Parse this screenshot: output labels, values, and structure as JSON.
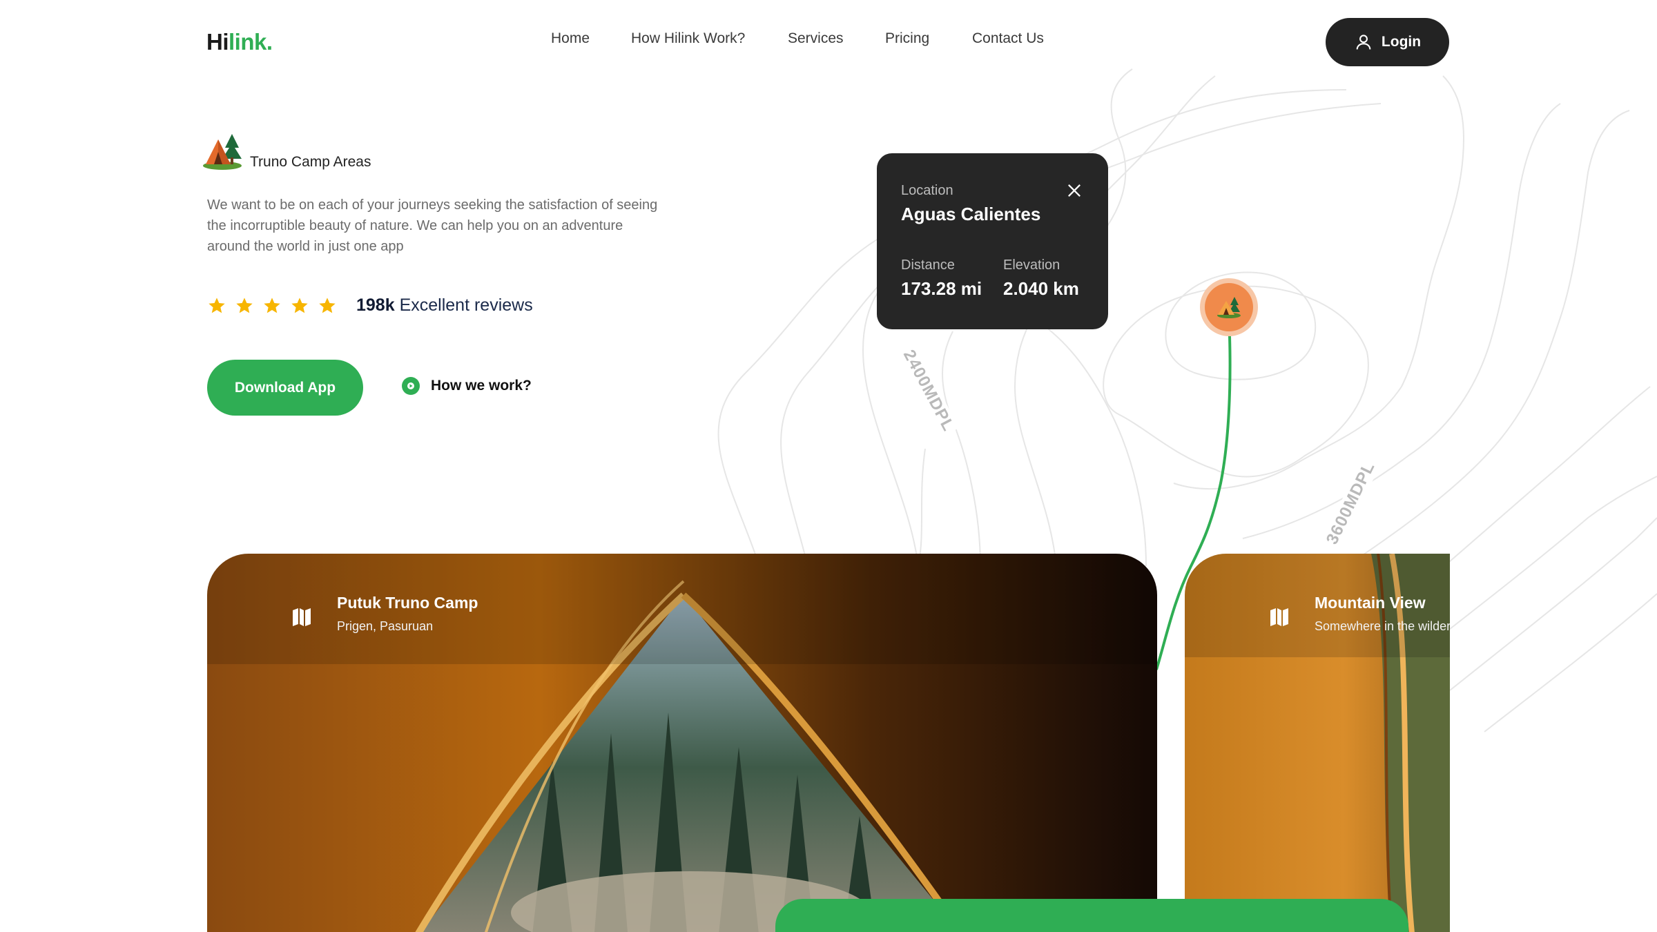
{
  "header": {
    "logo_part1": "Hi",
    "logo_part2": "link.",
    "nav": [
      "Home",
      "How Hilink Work?",
      "Services",
      "Pricing",
      "Contact Us"
    ],
    "login_label": "Login"
  },
  "hero": {
    "badge_label": "Truno Camp Areas",
    "description": "We want to be on each of your journeys seeking the satisfaction of seeing the incorruptible beauty of nature. We can help you on an adventure around the world in just one app",
    "rating_stars": 5,
    "reviews_count": "198k",
    "reviews_label": "Excellent reviews",
    "download_label": "Download App",
    "how_label": "How we work?"
  },
  "location_card": {
    "location_label": "Location",
    "location_name": "Aguas Calientes",
    "distance_label": "Distance",
    "distance_value": "173.28 mi",
    "elevation_label": "Elevation",
    "elevation_value": "2.040 km"
  },
  "map": {
    "contour_label_1": "2400MDPL",
    "contour_label_2": "3600MDPL"
  },
  "cards": [
    {
      "title": "Putuk Truno Camp",
      "subtitle": "Prigen, Pasuruan",
      "icon": "map-icon"
    },
    {
      "title": "Mountain View",
      "subtitle": "Somewhere in the wilderness",
      "icon": "map-icon"
    }
  ],
  "colors": {
    "brand_green": "#2fae54",
    "dark": "#232323",
    "star": "#f7b500",
    "marker": "#f08a4b"
  }
}
